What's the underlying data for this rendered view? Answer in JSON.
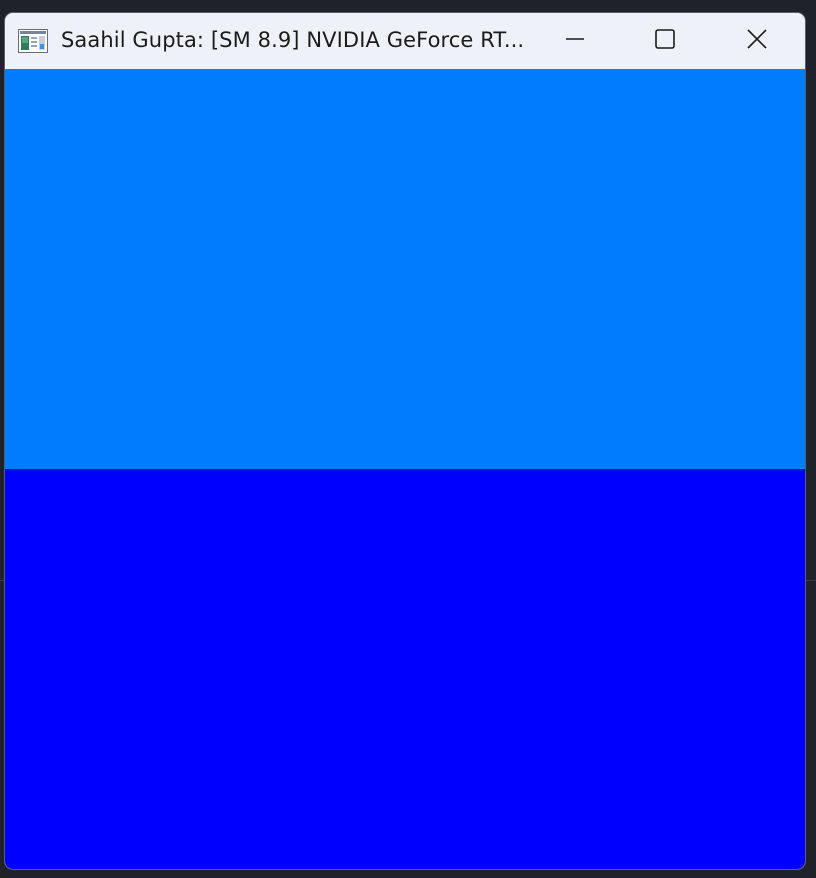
{
  "window": {
    "title": "Saahil Gupta: [SM 8.9] NVIDIA GeForce RT...",
    "icon": "app-window-icon",
    "controls": {
      "minimize_icon": "minimize-icon",
      "maximize_icon": "maximize-icon",
      "close_icon": "close-icon"
    }
  },
  "canvas": {
    "top_color": "#007cff",
    "bottom_color": "#0000ff"
  },
  "colors": {
    "titlebar_bg": "#eef2f8",
    "title_text": "#1b1b1b",
    "desktop_bg": "#1f2229"
  }
}
